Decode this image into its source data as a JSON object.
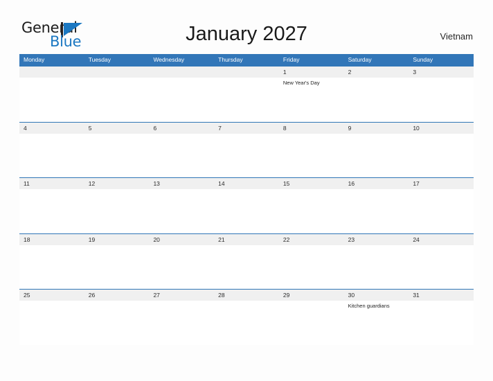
{
  "brand": {
    "name_part1": "General",
    "name_part2": "Blue",
    "mark": "flag-triangle"
  },
  "header": {
    "title": "January 2027",
    "country": "Vietnam"
  },
  "calendar": {
    "weekdays": [
      "Monday",
      "Tuesday",
      "Wednesday",
      "Thursday",
      "Friday",
      "Saturday",
      "Sunday"
    ],
    "weeks": [
      {
        "days": [
          {
            "date": "",
            "event": ""
          },
          {
            "date": "",
            "event": ""
          },
          {
            "date": "",
            "event": ""
          },
          {
            "date": "",
            "event": ""
          },
          {
            "date": "1",
            "event": "New Year's Day"
          },
          {
            "date": "2",
            "event": ""
          },
          {
            "date": "3",
            "event": ""
          }
        ]
      },
      {
        "days": [
          {
            "date": "4",
            "event": ""
          },
          {
            "date": "5",
            "event": ""
          },
          {
            "date": "6",
            "event": ""
          },
          {
            "date": "7",
            "event": ""
          },
          {
            "date": "8",
            "event": ""
          },
          {
            "date": "9",
            "event": ""
          },
          {
            "date": "10",
            "event": ""
          }
        ]
      },
      {
        "days": [
          {
            "date": "11",
            "event": ""
          },
          {
            "date": "12",
            "event": ""
          },
          {
            "date": "13",
            "event": ""
          },
          {
            "date": "14",
            "event": ""
          },
          {
            "date": "15",
            "event": ""
          },
          {
            "date": "16",
            "event": ""
          },
          {
            "date": "17",
            "event": ""
          }
        ]
      },
      {
        "days": [
          {
            "date": "18",
            "event": ""
          },
          {
            "date": "19",
            "event": ""
          },
          {
            "date": "20",
            "event": ""
          },
          {
            "date": "21",
            "event": ""
          },
          {
            "date": "22",
            "event": ""
          },
          {
            "date": "23",
            "event": ""
          },
          {
            "date": "24",
            "event": ""
          }
        ]
      },
      {
        "days": [
          {
            "date": "25",
            "event": ""
          },
          {
            "date": "26",
            "event": ""
          },
          {
            "date": "27",
            "event": ""
          },
          {
            "date": "28",
            "event": ""
          },
          {
            "date": "29",
            "event": ""
          },
          {
            "date": "30",
            "event": "Kitchen guardians"
          },
          {
            "date": "31",
            "event": ""
          }
        ]
      }
    ]
  },
  "colors": {
    "header_blue": "#3276b8",
    "rule_blue": "#2e75b6",
    "brand_blue": "#1b78c2",
    "band_gray": "#f0f0f0"
  }
}
